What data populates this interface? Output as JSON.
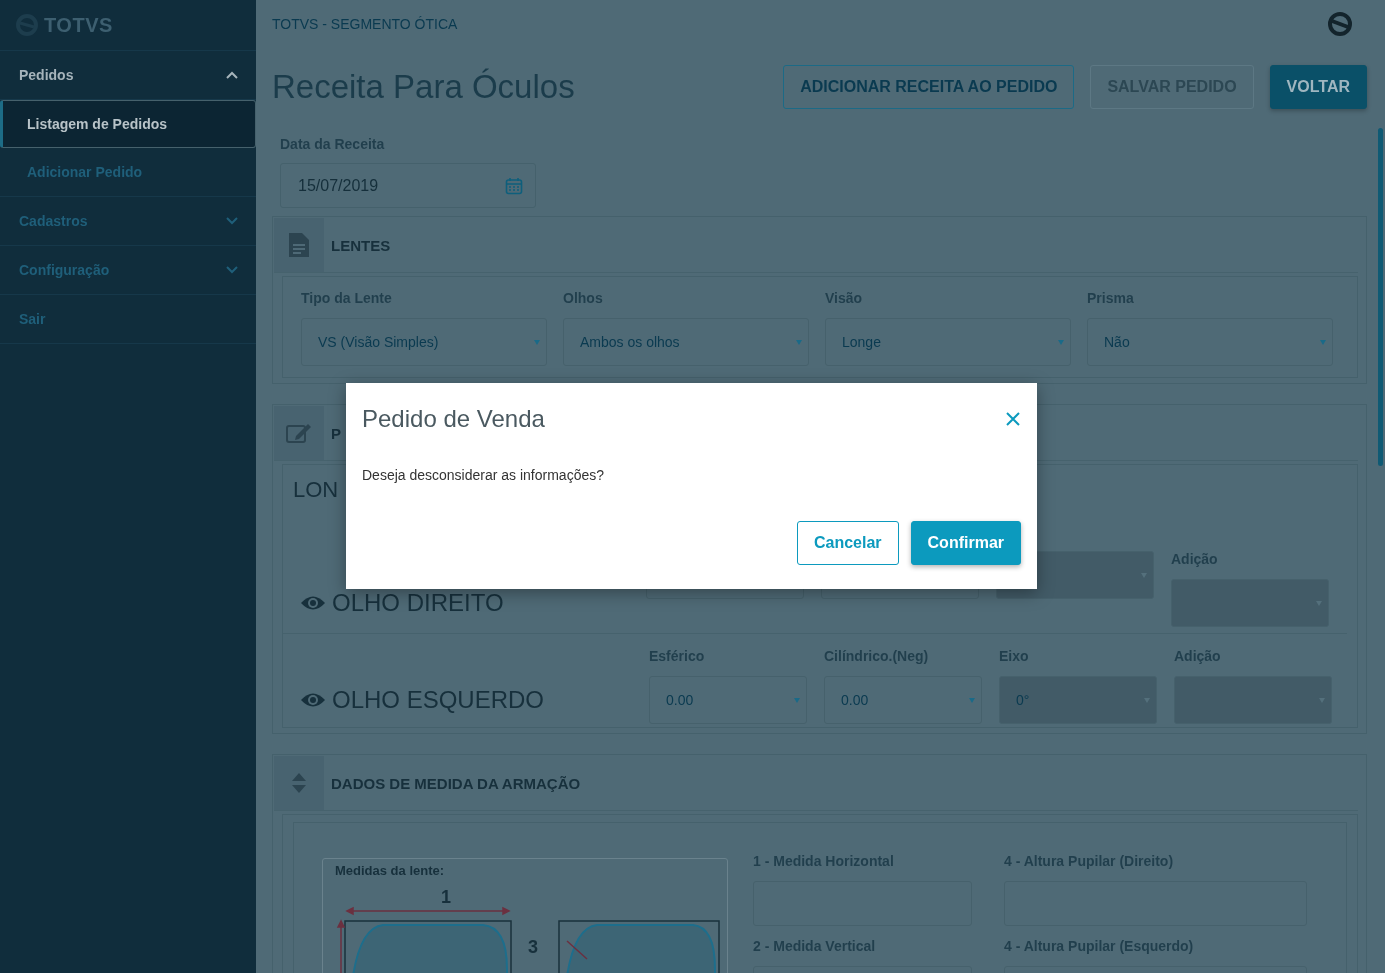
{
  "sidebar": {
    "logo": "TOTVS",
    "items": [
      {
        "label": "Pedidos",
        "kind": "group",
        "expanded": true,
        "selected": false,
        "children": [
          {
            "label": "Listagem de Pedidos",
            "selected": true
          },
          {
            "label": "Adicionar Pedido",
            "selected": false
          }
        ]
      },
      {
        "label": "Cadastros",
        "kind": "group",
        "expanded": false,
        "selected": false
      },
      {
        "label": "Configuração",
        "kind": "group",
        "expanded": false,
        "selected": false
      },
      {
        "label": "Sair",
        "kind": "link",
        "selected": false
      }
    ]
  },
  "breadcrumb": "TOTVS - SEGMENTO ÓTICA",
  "page_title": "Receita Para Óculos",
  "actions": [
    {
      "label": "ADICIONAR RECEITA AO PEDIDO",
      "kind": "outline",
      "disabled": false
    },
    {
      "label": "SALVAR PEDIDO",
      "kind": "outline",
      "disabled": true
    },
    {
      "label": "VOLTAR",
      "kind": "primary",
      "disabled": false
    }
  ],
  "date_field": {
    "label": "Data da Receita",
    "value": "15/07/2019"
  },
  "lentes": {
    "title": "LENTES",
    "fields": [
      {
        "label": "Tipo da Lente",
        "value": "VS (Visão Simples)"
      },
      {
        "label": "Olhos",
        "value": "Ambos os olhos"
      },
      {
        "label": "Visão",
        "value": "Longe"
      },
      {
        "label": "Prisma",
        "value": "Não"
      }
    ]
  },
  "prescription": {
    "title": "P",
    "subtitle": "LON",
    "eyes": [
      {
        "label": "OLHO DIREITO",
        "fields": [
          {
            "kind": "select"
          },
          {
            "kind": "select"
          },
          {
            "kind": "select",
            "disabled": true
          },
          {
            "kind": "select",
            "label": "Adição",
            "disabled": true
          }
        ]
      },
      {
        "label": "OLHO ESQUERDO",
        "fields": [
          {
            "kind": "select",
            "label": "Esférico",
            "value": "0.00",
            "disabled": false
          },
          {
            "kind": "select",
            "label": "Cilíndrico.(Neg)",
            "value": "0.00",
            "disabled": false
          },
          {
            "kind": "select",
            "label": "Eixo",
            "value": "0°",
            "disabled": true
          },
          {
            "kind": "select",
            "label": "Adição",
            "disabled": true
          }
        ]
      }
    ]
  },
  "frame": {
    "title": "DADOS DE MEDIDA DA ARMAÇÃO",
    "drawing": {
      "caption": "Medidas da lente:",
      "marks": [
        "1",
        "3"
      ]
    },
    "fields": [
      {
        "label": "1 - Medida Horizontal"
      },
      {
        "label": "4 - Altura Pupilar (Direito)"
      },
      {
        "label": "2 - Medida Vertical"
      },
      {
        "label": "4 - Altura Pupilar (Esquerdo)"
      }
    ]
  },
  "modal": {
    "title": "Pedido de Venda",
    "message": "Deseja desconsiderar as informações?",
    "buttons": [
      {
        "label": "Cancelar",
        "kind": "secondary"
      },
      {
        "label": "Confirmar",
        "kind": "primary"
      }
    ]
  }
}
